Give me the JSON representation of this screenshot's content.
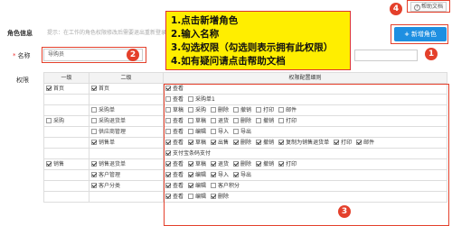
{
  "toolbar": {
    "help_label": "帮助文档",
    "add_label": "新增角色"
  },
  "role_info": {
    "label": "角色信息",
    "hint": "提示：在工作的角色权限修改后需要退出重新登录才会生效"
  },
  "name_field": {
    "label": "名称",
    "value": "导购员"
  },
  "perm_label": "权限",
  "table": {
    "headers": [
      "一级",
      "二级",
      "权限配置细则"
    ],
    "rows": [
      {
        "l1": "首页",
        "l1_checked": true,
        "l2": "首页",
        "l2_checked": true,
        "ops": [
          {
            "t": "查看",
            "c": true
          }
        ]
      },
      {
        "l1": "",
        "l2": "",
        "ops": [
          {
            "t": "查看",
            "c": false
          },
          {
            "t": "采购单1",
            "c": false
          }
        ]
      },
      {
        "l1": "",
        "l2": "采购单",
        "l2_checked": false,
        "ops": [
          {
            "t": "草稿",
            "c": false
          },
          {
            "t": "采购",
            "c": false
          },
          {
            "t": "删除",
            "c": false
          },
          {
            "t": "撤销",
            "c": false
          },
          {
            "t": "打印",
            "c": false
          },
          {
            "t": "邮件",
            "c": false
          }
        ]
      },
      {
        "l1": "采购",
        "l1_checked": false,
        "l2": "采购退货单",
        "l2_checked": false,
        "ops": [
          {
            "t": "查看",
            "c": false
          },
          {
            "t": "草稿",
            "c": false
          },
          {
            "t": "退货",
            "c": false
          },
          {
            "t": "删除",
            "c": false
          },
          {
            "t": "撤销",
            "c": false
          },
          {
            "t": "打印",
            "c": false
          }
        ]
      },
      {
        "l1": "",
        "l2": "供应商管理",
        "l2_checked": false,
        "ops": [
          {
            "t": "查看",
            "c": false
          },
          {
            "t": "编辑",
            "c": false
          },
          {
            "t": "导入",
            "c": false
          },
          {
            "t": "导出",
            "c": false
          }
        ]
      },
      {
        "l1": "",
        "l2": "销售单",
        "l2_checked": true,
        "ops": [
          {
            "t": "查看",
            "c": true
          },
          {
            "t": "草稿",
            "c": true
          },
          {
            "t": "出售",
            "c": true
          },
          {
            "t": "删除",
            "c": true
          },
          {
            "t": "撤销",
            "c": true
          },
          {
            "t": "复制为销售退货单",
            "c": true
          },
          {
            "t": "打印",
            "c": true
          },
          {
            "t": "邮件",
            "c": true
          }
        ]
      },
      {
        "l1": "",
        "l2": "",
        "ops": [
          {
            "t": "支付宝条码支付",
            "c": true
          }
        ]
      },
      {
        "l1": "销售",
        "l1_checked": true,
        "l2": "销售退货单",
        "l2_checked": true,
        "ops": [
          {
            "t": "查看",
            "c": true
          },
          {
            "t": "草稿",
            "c": true
          },
          {
            "t": "退货",
            "c": true
          },
          {
            "t": "删除",
            "c": true
          },
          {
            "t": "撤销",
            "c": true
          },
          {
            "t": "打印",
            "c": true
          }
        ]
      },
      {
        "l1": "",
        "l2": "客户管理",
        "l2_checked": true,
        "ops": [
          {
            "t": "查看",
            "c": true
          },
          {
            "t": "编辑",
            "c": true
          },
          {
            "t": "导入",
            "c": true
          },
          {
            "t": "导出",
            "c": true
          }
        ]
      },
      {
        "l1": "",
        "l2": "客户分类",
        "l2_checked": true,
        "ops": [
          {
            "t": "查看",
            "c": true
          },
          {
            "t": "编辑",
            "c": true
          },
          {
            "t": "客户积分",
            "c": false
          }
        ]
      },
      {
        "l1": "",
        "l2": "",
        "ops": [
          {
            "t": "查看",
            "c": true
          },
          {
            "t": "编辑",
            "c": false
          },
          {
            "t": "删除",
            "c": true
          }
        ]
      }
    ]
  },
  "notes": {
    "lines": [
      "1.点击新增角色",
      "2.输入名称",
      "3.勾选权限（勾选则表示拥有此权限）",
      "4.如有疑问请点击帮助文档"
    ]
  },
  "badges": {
    "b1": "1",
    "b2": "2",
    "b3": "3",
    "b4": "4"
  },
  "colors": {
    "accent": "#1e8fe1",
    "annotation": "#e4402b",
    "note_bg": "#ffee00"
  }
}
